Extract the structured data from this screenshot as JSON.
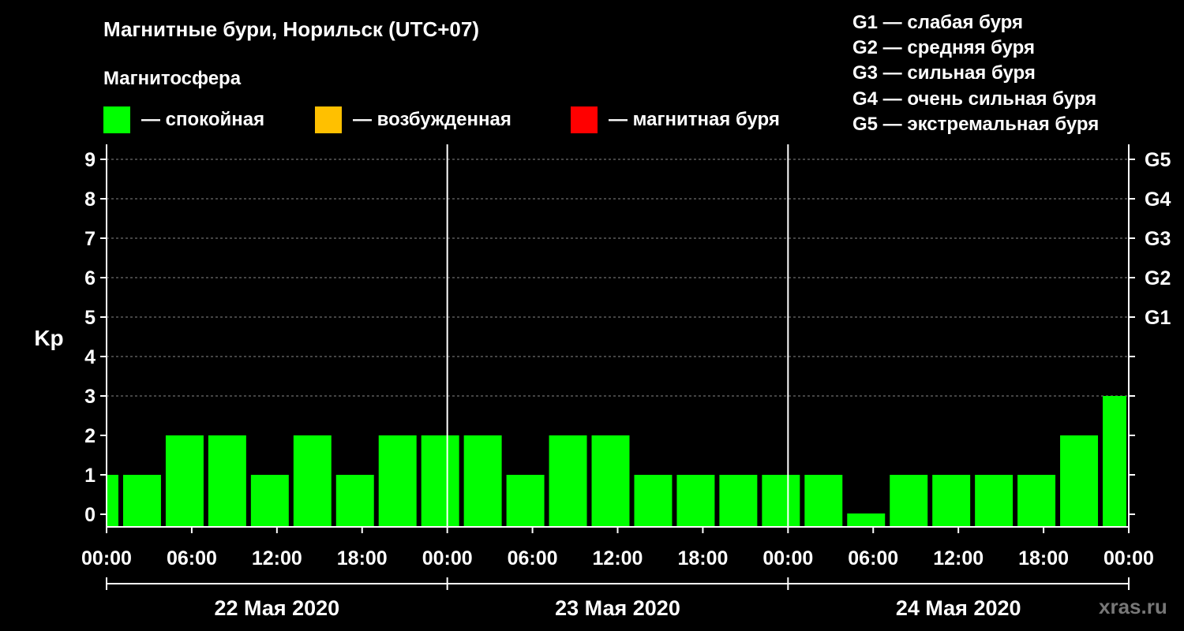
{
  "title": "Магнитные бури, Норильск (UTC+07)",
  "subtitle": "Магнитосфера",
  "legend": [
    {
      "color": "#00ff00",
      "label": "— спокойная"
    },
    {
      "color": "#ffc000",
      "label": "— возбужденная"
    },
    {
      "color": "#ff0000",
      "label": "— магнитная буря"
    }
  ],
  "g_scale": [
    "G1 — слабая буря",
    "G2 — средняя буря",
    "G3 — сильная буря",
    "G4 — очень сильная буря",
    "G5 — экстремальная буря"
  ],
  "watermark": "xras.ru",
  "colors": {
    "calm": "#00ff00",
    "excited": "#ffc000",
    "storm": "#ff0000",
    "background": "#000000"
  },
  "chart_data": {
    "type": "bar",
    "ylabel": "Kp",
    "ylim": [
      0,
      9
    ],
    "yticks": [
      "0",
      "1",
      "2",
      "3",
      "4",
      "5",
      "6",
      "7",
      "8",
      "9"
    ],
    "right_ticks": [
      {
        "value": 5,
        "label": "G1"
      },
      {
        "value": 6,
        "label": "G2"
      },
      {
        "value": 7,
        "label": "G3"
      },
      {
        "value": 8,
        "label": "G4"
      },
      {
        "value": 9,
        "label": "G5"
      }
    ],
    "xtick_labels": [
      "00:00",
      "06:00",
      "12:00",
      "18:00",
      "00:00",
      "06:00",
      "12:00",
      "18:00",
      "00:00",
      "06:00",
      "12:00",
      "18:00",
      "00:00"
    ],
    "days": [
      "22 Мая 2020",
      "23 Мая 2020",
      "24 Мая 2020"
    ],
    "x_range_hours": [
      0,
      72
    ],
    "grid": "dashed horizontal",
    "bars": [
      {
        "start": 0,
        "end": 1,
        "kp": 1
      },
      {
        "start": 1,
        "end": 4,
        "kp": 1
      },
      {
        "start": 4,
        "end": 7,
        "kp": 2
      },
      {
        "start": 7,
        "end": 10,
        "kp": 2
      },
      {
        "start": 10,
        "end": 13,
        "kp": 1
      },
      {
        "start": 13,
        "end": 16,
        "kp": 2
      },
      {
        "start": 16,
        "end": 19,
        "kp": 1
      },
      {
        "start": 19,
        "end": 22,
        "kp": 2
      },
      {
        "start": 22,
        "end": 25,
        "kp": 2
      },
      {
        "start": 25,
        "end": 28,
        "kp": 2
      },
      {
        "start": 28,
        "end": 31,
        "kp": 1
      },
      {
        "start": 31,
        "end": 34,
        "kp": 2
      },
      {
        "start": 34,
        "end": 37,
        "kp": 2
      },
      {
        "start": 37,
        "end": 40,
        "kp": 1
      },
      {
        "start": 40,
        "end": 43,
        "kp": 1
      },
      {
        "start": 43,
        "end": 46,
        "kp": 1
      },
      {
        "start": 46,
        "end": 49,
        "kp": 1
      },
      {
        "start": 49,
        "end": 52,
        "kp": 1
      },
      {
        "start": 52,
        "end": 55,
        "kp": 0
      },
      {
        "start": 55,
        "end": 58,
        "kp": 1
      },
      {
        "start": 58,
        "end": 61,
        "kp": 1
      },
      {
        "start": 61,
        "end": 64,
        "kp": 1
      },
      {
        "start": 64,
        "end": 67,
        "kp": 1
      },
      {
        "start": 67,
        "end": 70,
        "kp": 2
      },
      {
        "start": 70,
        "end": 72,
        "kp": 3
      }
    ]
  }
}
